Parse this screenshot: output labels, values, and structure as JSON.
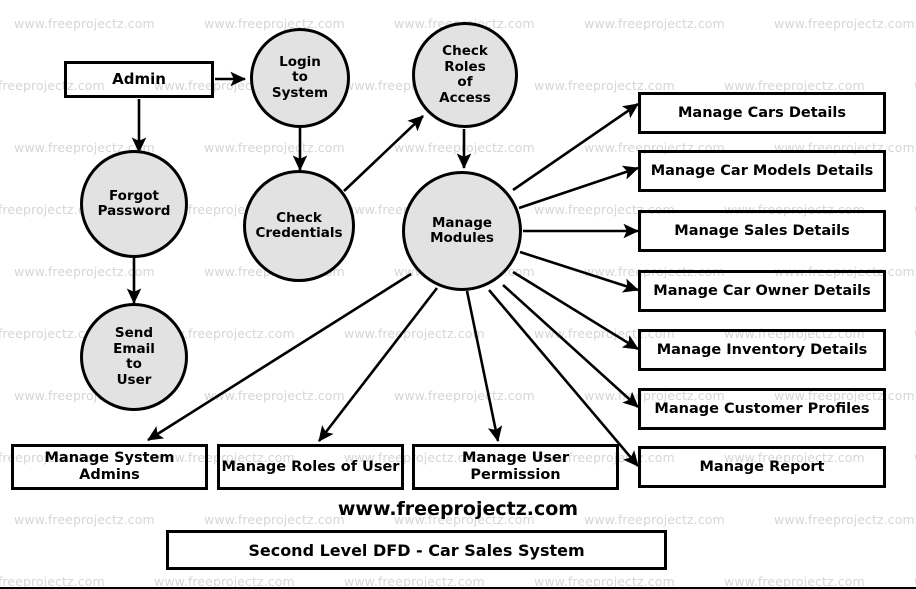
{
  "diagram": {
    "title": "Second Level DFD - Car Sales System",
    "site_label": "www.freeprojectz.com",
    "watermark_text": "www.freeprojectz.com",
    "colors": {
      "process_fill": "#e2e2e2",
      "stroke": "#000000",
      "background": "#ffffff",
      "watermark": "#d6d6d6"
    }
  },
  "entities": [
    {
      "id": "admin",
      "label": "Admin"
    }
  ],
  "processes": [
    {
      "id": "login_to_system",
      "label": "Login\nto\nSystem",
      "lines": [
        "Login",
        "to",
        "System"
      ]
    },
    {
      "id": "check_roles_of_access",
      "label": "Check Roles of Access",
      "lines": [
        "Check",
        "Roles",
        "of",
        "Access"
      ]
    },
    {
      "id": "forgot_password",
      "label": "Forgot Password",
      "lines": [
        "Forgot",
        "Password"
      ]
    },
    {
      "id": "check_credentials",
      "label": "Check Credentials",
      "lines": [
        "Check",
        "Credentials"
      ]
    },
    {
      "id": "send_email_to_user",
      "label": "Send Email to User",
      "lines": [
        "Send",
        "Email",
        "to",
        "User"
      ]
    },
    {
      "id": "manage_modules",
      "label": "Manage Modules",
      "lines": [
        "Manage",
        "Modules"
      ]
    }
  ],
  "right_boxes": [
    {
      "id": "manage_cars_details",
      "label": "Manage Cars Details"
    },
    {
      "id": "manage_car_models_details",
      "label": "Manage Car Models Details"
    },
    {
      "id": "manage_sales_details",
      "label": "Manage Sales Details"
    },
    {
      "id": "manage_car_owner_details",
      "label": "Manage Car Owner Details"
    },
    {
      "id": "manage_inventory_details",
      "label": "Manage Inventory Details"
    },
    {
      "id": "manage_customer_profiles",
      "label": "Manage Customer Profiles"
    },
    {
      "id": "manage_report",
      "label": "Manage Report"
    }
  ],
  "bottom_boxes": [
    {
      "id": "manage_system_admins",
      "label": "Manage System Admins"
    },
    {
      "id": "manage_roles_of_user",
      "label": "Manage Roles of User"
    },
    {
      "id": "manage_user_permission",
      "label": "Manage User Permission"
    }
  ],
  "flows": [
    {
      "from": "admin",
      "to": "login_to_system"
    },
    {
      "from": "admin",
      "to": "forgot_password"
    },
    {
      "from": "forgot_password",
      "to": "send_email_to_user"
    },
    {
      "from": "login_to_system",
      "to": "check_credentials"
    },
    {
      "from": "check_credentials",
      "to": "check_roles_of_access"
    },
    {
      "from": "check_roles_of_access",
      "to": "manage_modules"
    },
    {
      "from": "manage_modules",
      "to": "manage_cars_details"
    },
    {
      "from": "manage_modules",
      "to": "manage_car_models_details"
    },
    {
      "from": "manage_modules",
      "to": "manage_sales_details"
    },
    {
      "from": "manage_modules",
      "to": "manage_car_owner_details"
    },
    {
      "from": "manage_modules",
      "to": "manage_inventory_details"
    },
    {
      "from": "manage_modules",
      "to": "manage_customer_profiles"
    },
    {
      "from": "manage_modules",
      "to": "manage_report"
    },
    {
      "from": "manage_modules",
      "to": "manage_system_admins"
    },
    {
      "from": "manage_modules",
      "to": "manage_roles_of_user"
    },
    {
      "from": "manage_modules",
      "to": "manage_user_permission"
    }
  ]
}
